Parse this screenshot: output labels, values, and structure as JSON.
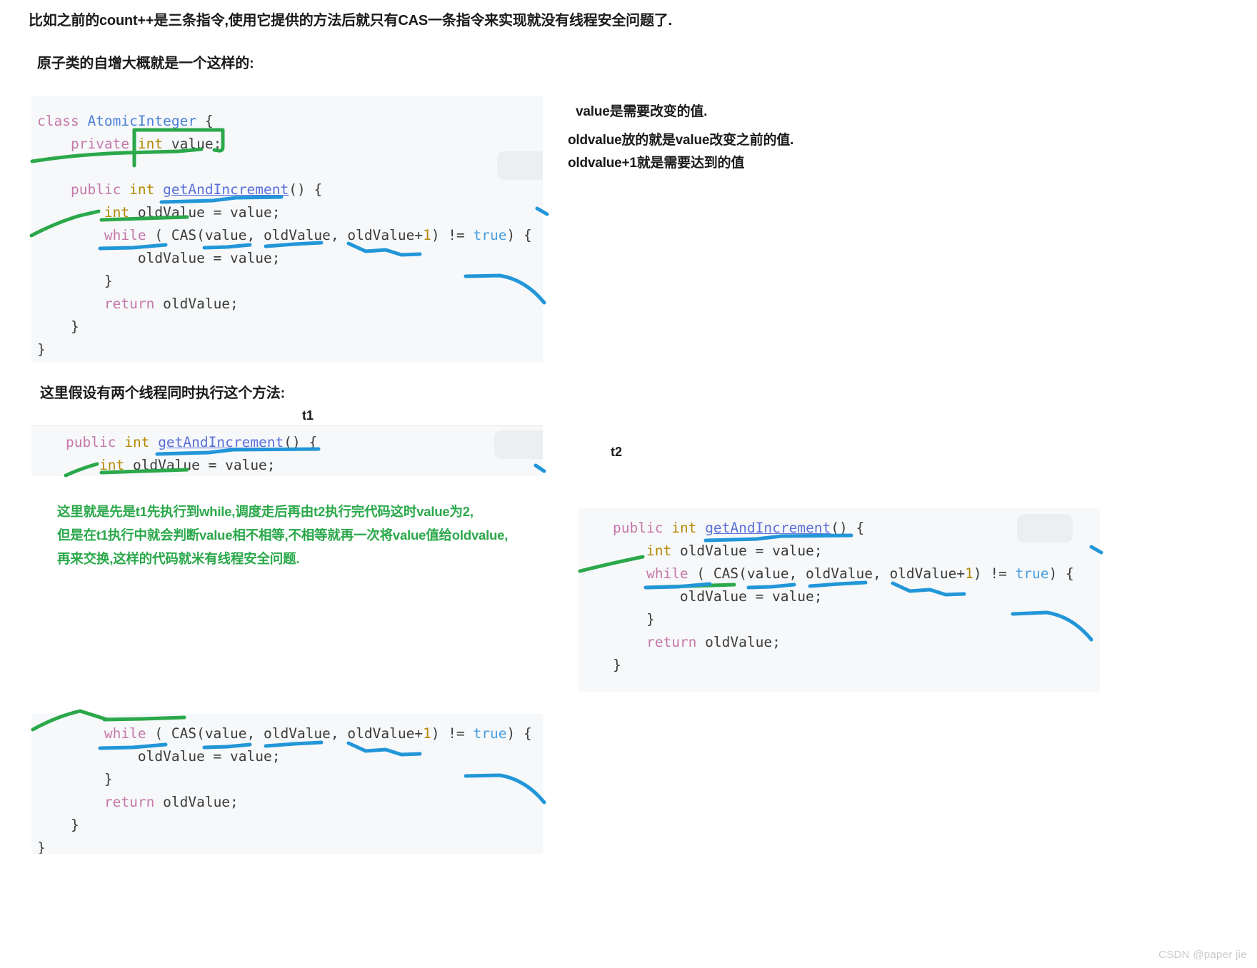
{
  "prose": {
    "intro": "比如之前的count++是三条指令,使用它提供的方法后就只有CAS一条指令来实现就没有线程安全问题了.",
    "lead": "原子类的自增大概就是一个这样的:",
    "assume": "这里假设有两个线程同时执行这个方法:"
  },
  "notes": {
    "line1": "value是需要改变的值.",
    "line2": "oldvalue放的就是value改变之前的值.",
    "line3": "oldvalue+1就是需要达到的值"
  },
  "thread_labels": {
    "t1": "t1",
    "t2": "t2"
  },
  "code_main": {
    "lines": [
      "class AtomicInteger {",
      "    private int value;",
      "",
      "    public int getAndIncrement() {",
      "        int oldValue = value;",
      "        while ( CAS(value, oldValue, oldValue+1) != true) {",
      "            oldValue = value;",
      "        }",
      "        return oldValue;",
      "    }",
      "}"
    ]
  },
  "code_t1": {
    "lines": [
      "public int getAndIncrement() {",
      "    int oldValue = value;"
    ]
  },
  "code_t2": {
    "lines": [
      "public int getAndIncrement() {",
      "    int oldValue = value;",
      "    while ( CAS(value, oldValue, oldValue+1) != true) {",
      "        oldValue = value;",
      "    }",
      "    return oldValue;",
      "}"
    ]
  },
  "code_bottom": {
    "lines": [
      "        while ( CAS(value, oldValue, oldValue+1) != true) {",
      "            oldValue = value;",
      "        }",
      "        return oldValue;",
      "    }",
      "}"
    ]
  },
  "green_note": {
    "line1": "这里就是先是t1先执行到while,调度走后再由t2执行完代码这时value为2,",
    "line2": "但是在t1执行中就会判断value相不相等,不相等就再一次将value值给oldvalue,",
    "line3": "再来交换,这样的代码就米有线程安全问题."
  },
  "watermark": "CSDN @paper jie",
  "colors": {
    "code_background": "#f6f8fa",
    "keyword": "#c678a9",
    "type": "#b58900",
    "class_name": "#4a7fd6",
    "method_name": "#5b6fd8",
    "boolean": "#4a9fe0",
    "ink_green": "#2aa84a",
    "ink_blue": "#2196d8",
    "note_green_text": "#2aa84a",
    "watermark": "#c9c9c9"
  }
}
